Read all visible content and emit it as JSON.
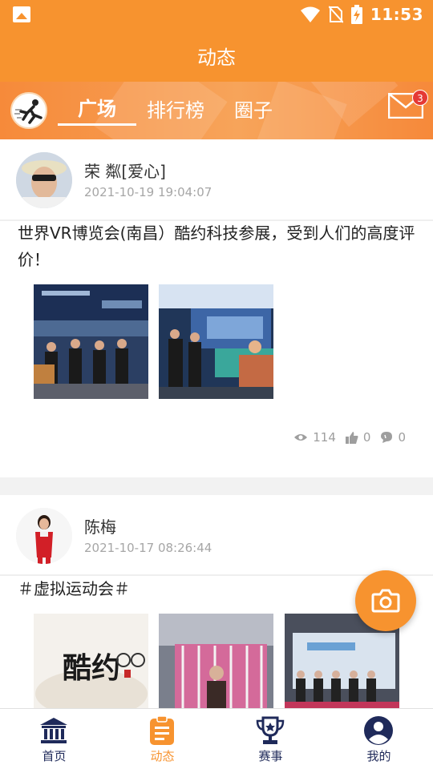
{
  "status_bar": {
    "time": "11:53"
  },
  "app_bar": {
    "title": "动态"
  },
  "tabs": [
    {
      "label": "广场",
      "active": true
    },
    {
      "label": "排行榜",
      "active": false
    },
    {
      "label": "圈子",
      "active": false
    }
  ],
  "messages": {
    "badge": "3"
  },
  "posts": [
    {
      "author": "荣 粼[爱心]",
      "time": "2021-10-19 19:04:07",
      "text": "世界VR博览会(南昌）酷约科技参展，受到人们的高度评价！",
      "views": "114",
      "likes": "0",
      "comments": "0"
    },
    {
      "author": "陈梅",
      "time": "2021-10-17 08:26:44",
      "text": "＃虚拟运动会＃"
    }
  ],
  "nav": [
    {
      "label": "首页",
      "active": false,
      "icon": "bank-icon"
    },
    {
      "label": "动态",
      "active": true,
      "icon": "clipboard-icon"
    },
    {
      "label": "赛事",
      "active": false,
      "icon": "trophy-icon"
    },
    {
      "label": "我的",
      "active": false,
      "icon": "user-icon"
    }
  ],
  "colors": {
    "accent": "#f7932f",
    "nav_dark": "#1f2a5a",
    "badge": "#e53935"
  }
}
